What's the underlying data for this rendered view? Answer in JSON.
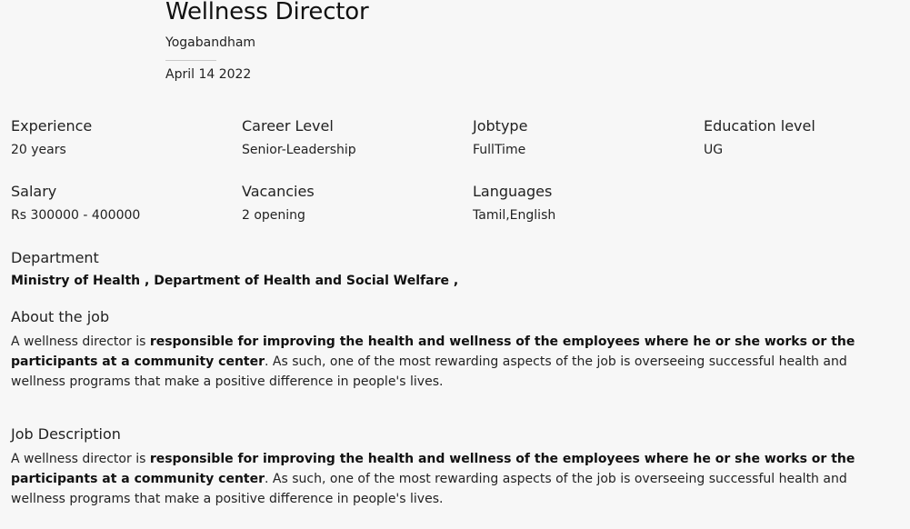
{
  "header": {
    "title": "Wellness Director",
    "company": "Yogabandham",
    "date": "April 14 2022"
  },
  "details": [
    {
      "label": "Experience",
      "value": "20 years"
    },
    {
      "label": "Career Level",
      "value": "Senior-Leadership"
    },
    {
      "label": "Jobtype",
      "value": "FullTime"
    },
    {
      "label": "Education level",
      "value": "UG"
    },
    {
      "label": "Salary",
      "value": "Rs 300000 - 400000"
    },
    {
      "label": "Vacancies",
      "value": "2 opening"
    },
    {
      "label": "Languages",
      "value": "Tamil,English"
    }
  ],
  "department": {
    "label": "Department",
    "value": "Ministry of Health , Department of Health and Social Welfare ,"
  },
  "about": {
    "label": "About the job",
    "text_start": "A wellness director is ",
    "text_bold": "responsible for improving the health and wellness of the employees where he or she works or the participants at a community center",
    "text_end": ". As such, one of the most rewarding aspects of the job is overseeing successful health and wellness programs that make a positive difference in people's lives."
  },
  "description": {
    "label": "Job Description",
    "text_start": "A wellness director is ",
    "text_bold": "responsible for improving the health and wellness of the employees where he or she works or the participants at a community center",
    "text_end": ". As such, one of the most rewarding aspects of the job is overseeing successful health and wellness programs that make a positive difference in people's lives."
  }
}
